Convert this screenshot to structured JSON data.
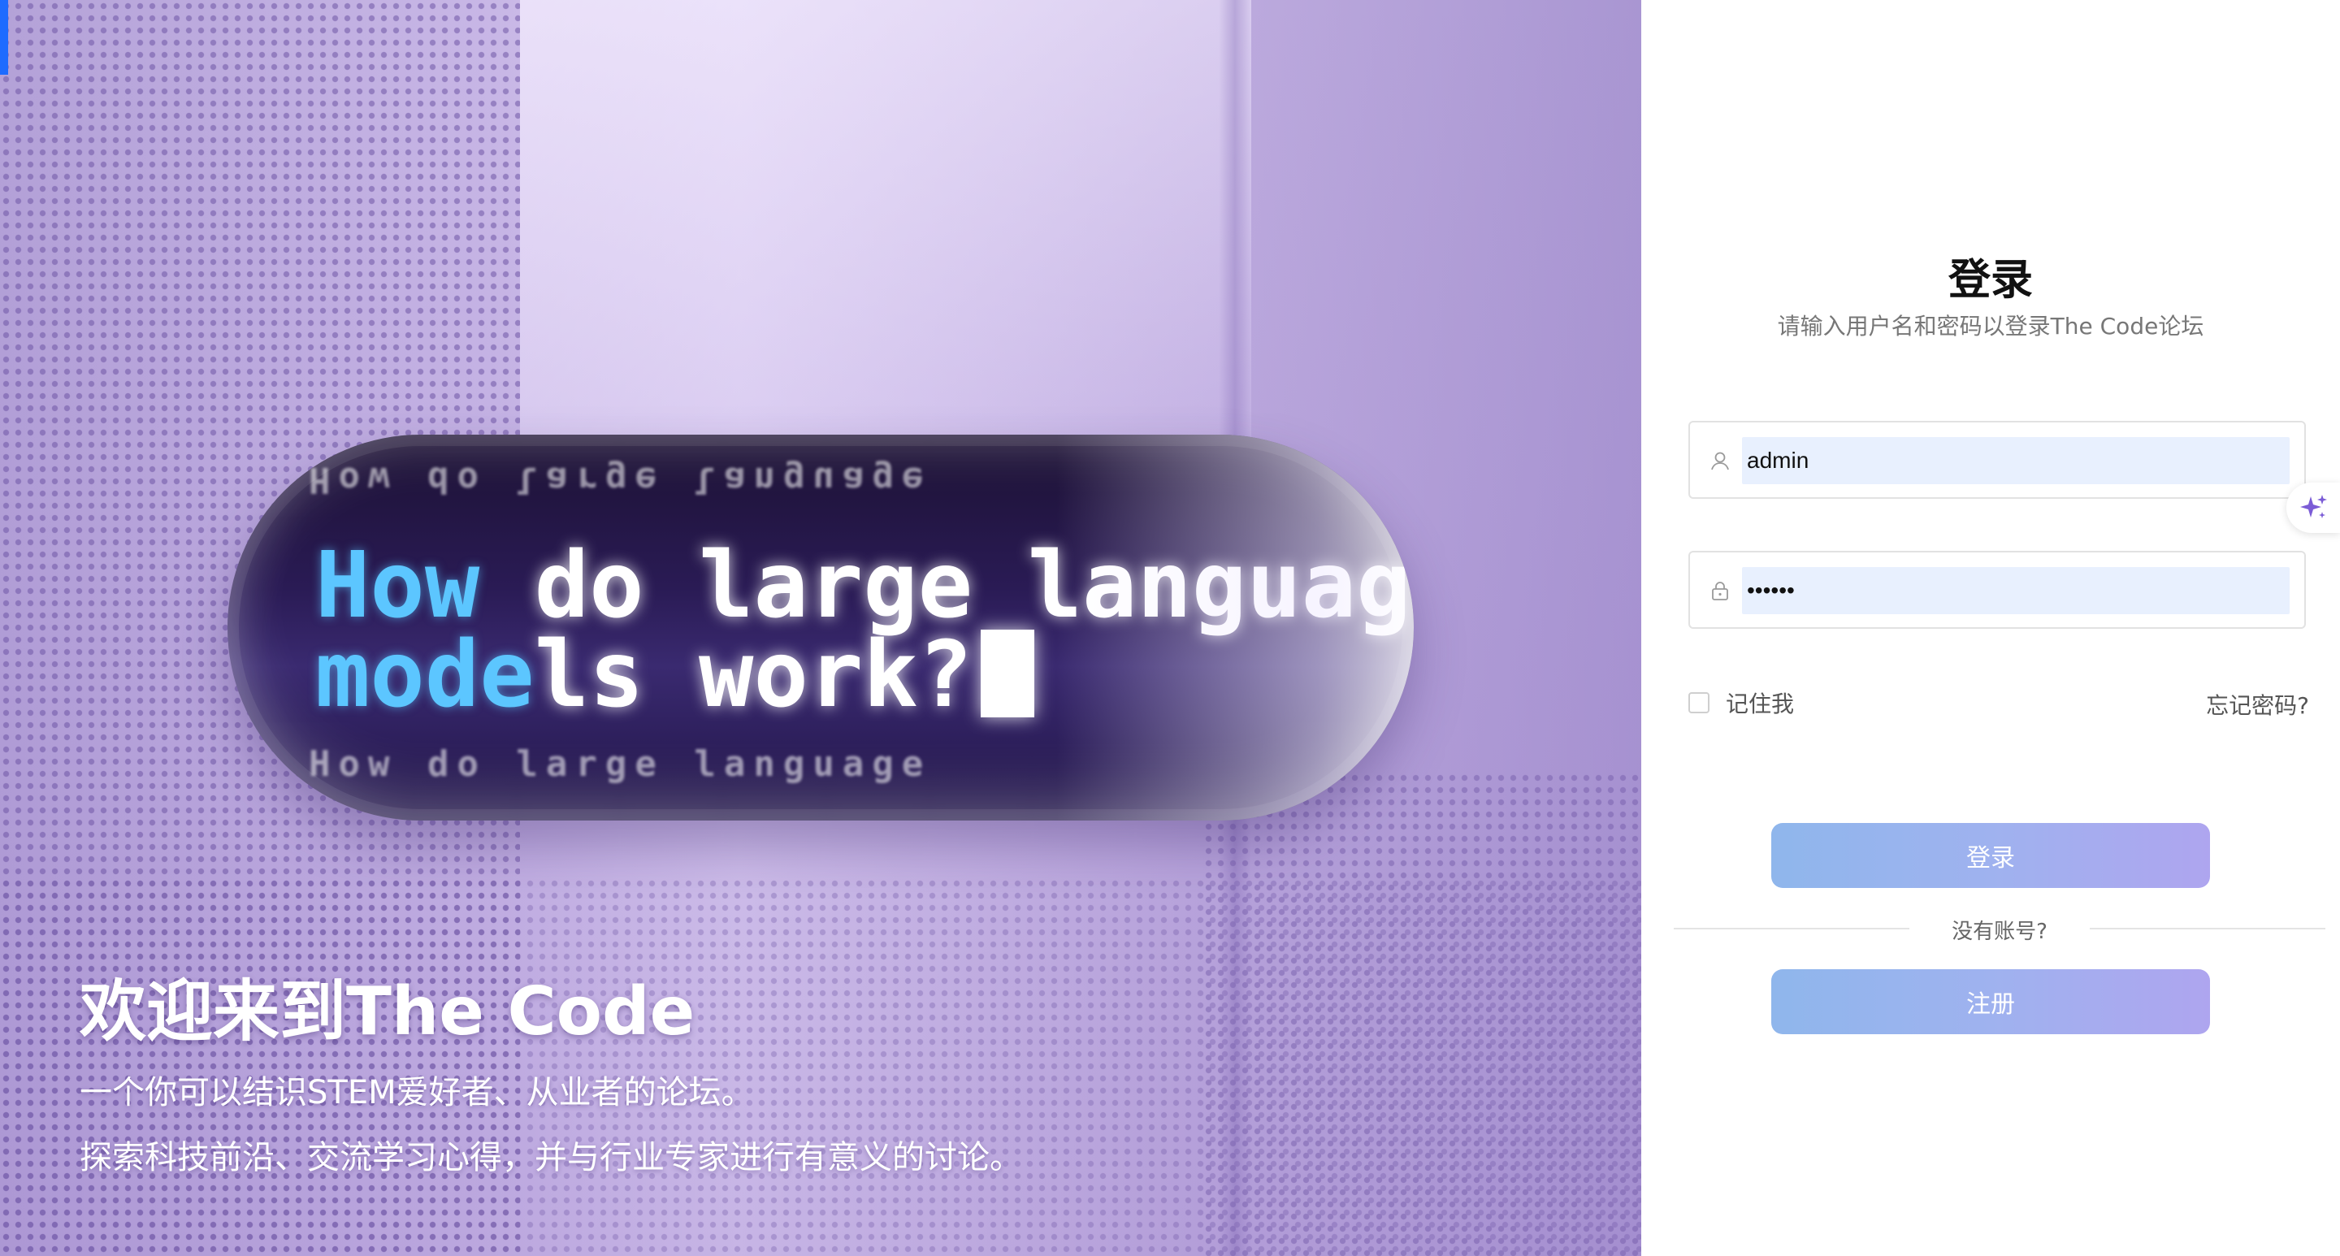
{
  "hero": {
    "code_line_1": {
      "prefix": "How",
      "rest": " do large languag"
    },
    "code_line_2": {
      "prefix": "mode",
      "rest": "ls work?"
    },
    "ghost_text": "How do large language",
    "title": "欢迎来到The Code",
    "subtitle_1": "一个你可以结识STEM爱好者、从业者的论坛。",
    "subtitle_2": "探索科技前沿、交流学习心得，并与行业专家进行有意义的讨论。"
  },
  "login": {
    "title": "登录",
    "subtitle": "请输入用户名和密码以登录The Code论坛",
    "username": {
      "value": "admin",
      "icon": "user-icon"
    },
    "password": {
      "value": "••••••",
      "icon": "lock-icon"
    },
    "remember_label": "记住我",
    "forgot_label": "忘记密码?",
    "login_button": "登录",
    "no_account": "没有账号?",
    "register_button": "注册"
  },
  "colors": {
    "button_gradient_start": "#8fb6ec",
    "button_gradient_end": "#aea5ef",
    "input_autofill": "#e8f0fe",
    "accent_tab": "#1e6bff",
    "ai_sparkle": "#7b5cd6"
  }
}
